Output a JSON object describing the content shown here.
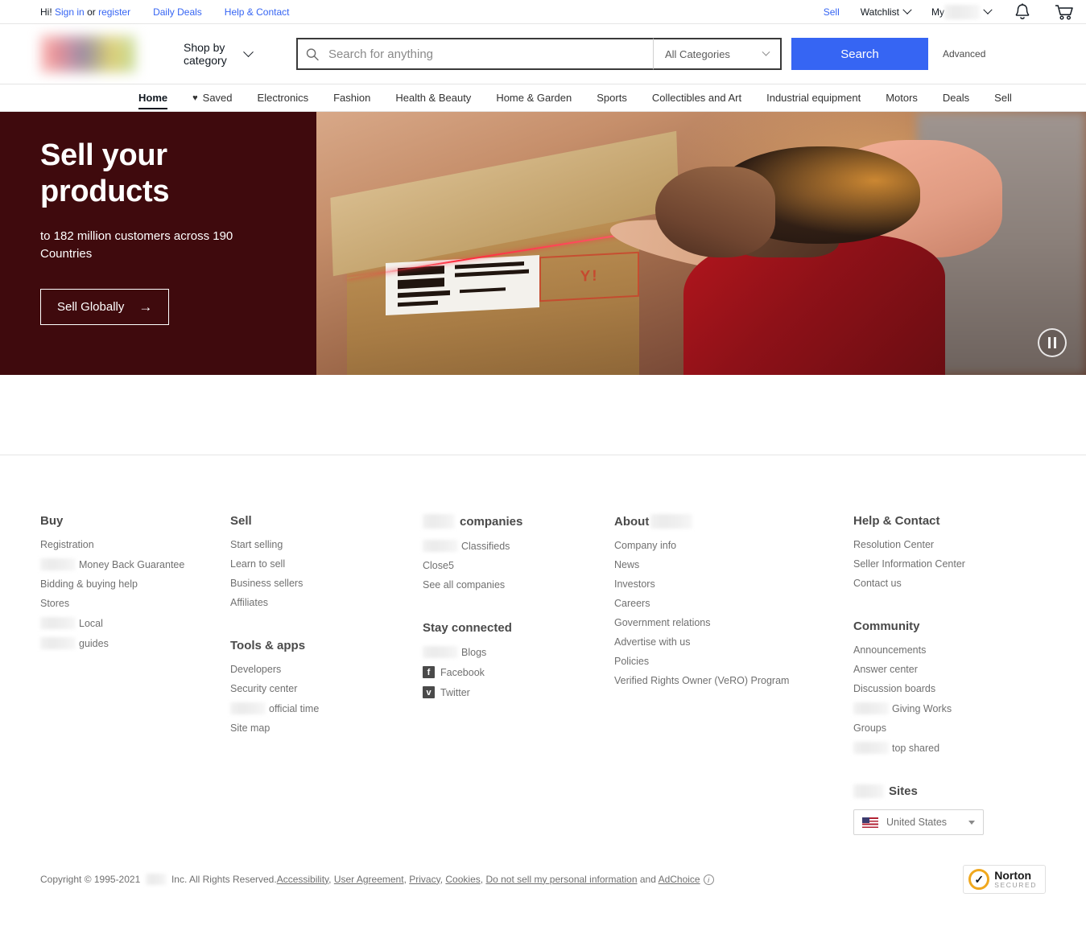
{
  "topbar": {
    "greeting": "Hi!",
    "sign_in": "Sign in",
    "or": "or",
    "register": "register",
    "daily_deals": "Daily Deals",
    "help_contact": "Help & Contact",
    "sell": "Sell",
    "watchlist": "Watchlist",
    "my_prefix": "My",
    "bell_icon": "bell-icon",
    "cart_icon": "cart-icon"
  },
  "header": {
    "logo_icon": "site-logo-redacted",
    "shop_by_line1": "Shop by",
    "shop_by_line2": "category",
    "search_placeholder": "Search for anything",
    "search_value": "",
    "search_icon": "search-icon",
    "category_selected": "All Categories",
    "search_button": "Search",
    "advanced": "Advanced"
  },
  "nav": {
    "items": [
      {
        "label": "Home",
        "active": true,
        "icon": ""
      },
      {
        "label": "Saved",
        "active": false,
        "icon": "heart-icon"
      },
      {
        "label": "Electronics",
        "active": false,
        "icon": ""
      },
      {
        "label": "Fashion",
        "active": false,
        "icon": ""
      },
      {
        "label": "Health & Beauty",
        "active": false,
        "icon": ""
      },
      {
        "label": "Home & Garden",
        "active": false,
        "icon": ""
      },
      {
        "label": "Sports",
        "active": false,
        "icon": ""
      },
      {
        "label": "Collectibles and Art",
        "active": false,
        "icon": ""
      },
      {
        "label": "Industrial equipment",
        "active": false,
        "icon": ""
      },
      {
        "label": "Motors",
        "active": false,
        "icon": ""
      },
      {
        "label": "Deals",
        "active": false,
        "icon": ""
      },
      {
        "label": "Sell",
        "active": false,
        "icon": ""
      }
    ]
  },
  "hero": {
    "title_line1": "Sell your",
    "title_line2": "products",
    "subtitle": "to 182 million customers across 190 Countries",
    "cta_label": "Sell Globally",
    "cta_arrow": "→",
    "bg_color": "#3f0a0d",
    "pause_icon": "pause-icon",
    "image_alt": "person scanning a cardboard package with a barcode scanner"
  },
  "footer": {
    "columns": [
      {
        "heading": "Buy",
        "links": [
          {
            "label": "Registration",
            "redacted_prefix": false
          },
          {
            "label": "Money Back Guarantee",
            "redacted_prefix": true
          },
          {
            "label": "Bidding & buying help",
            "redacted_prefix": false
          },
          {
            "label": "Stores",
            "redacted_prefix": false
          },
          {
            "label": "Local",
            "redacted_prefix": true
          },
          {
            "label": "guides",
            "redacted_prefix": true
          }
        ]
      },
      {
        "heading": "Sell",
        "links": [
          {
            "label": "Start selling",
            "redacted_prefix": false
          },
          {
            "label": "Learn to sell",
            "redacted_prefix": false
          },
          {
            "label": "Business sellers",
            "redacted_prefix": false
          },
          {
            "label": "Affiliates",
            "redacted_prefix": false
          }
        ],
        "heading2": "Tools & apps",
        "links2": [
          {
            "label": "Developers",
            "redacted_prefix": false
          },
          {
            "label": "Security center",
            "redacted_prefix": false
          },
          {
            "label": "official time",
            "redacted_prefix": true
          },
          {
            "label": "Site map",
            "redacted_prefix": false
          }
        ]
      },
      {
        "heading": "companies",
        "heading_redacted_prefix": true,
        "links": [
          {
            "label": "Classifieds",
            "redacted_prefix": true
          },
          {
            "label": "Close5",
            "redacted_prefix": false
          },
          {
            "label": "See all companies",
            "redacted_prefix": false
          }
        ],
        "heading2": "Stay connected",
        "links2": [
          {
            "label": "Blogs",
            "redacted_prefix": true,
            "icon": ""
          },
          {
            "label": "Facebook",
            "redacted_prefix": false,
            "icon": "facebook-icon",
            "glyph": "f"
          },
          {
            "label": "Twitter",
            "redacted_prefix": false,
            "icon": "twitter-icon",
            "glyph": "ᴠ"
          }
        ]
      },
      {
        "heading": "About",
        "heading_redacted_suffix": true,
        "links": [
          {
            "label": "Company info",
            "redacted_prefix": false
          },
          {
            "label": "News",
            "redacted_prefix": false
          },
          {
            "label": "Investors",
            "redacted_prefix": false
          },
          {
            "label": "Careers",
            "redacted_prefix": false
          },
          {
            "label": "Government relations",
            "redacted_prefix": false
          },
          {
            "label": "Advertise with us",
            "redacted_prefix": false
          },
          {
            "label": "Policies",
            "redacted_prefix": false
          },
          {
            "label": "Verified Rights Owner (VeRO) Program",
            "redacted_prefix": false
          }
        ]
      },
      {
        "heading": "Help & Contact",
        "links": [
          {
            "label": "Resolution Center",
            "redacted_prefix": false
          },
          {
            "label": "Seller Information Center",
            "redacted_prefix": false
          },
          {
            "label": "Contact us",
            "redacted_prefix": false
          }
        ],
        "heading2": "Community",
        "links2": [
          {
            "label": "Announcements",
            "redacted_prefix": false
          },
          {
            "label": "Answer center",
            "redacted_prefix": false
          },
          {
            "label": "Discussion boards",
            "redacted_prefix": false
          },
          {
            "label": "Giving Works",
            "redacted_prefix": true
          },
          {
            "label": "Groups",
            "redacted_prefix": false
          },
          {
            "label": "top shared",
            "redacted_prefix": true
          }
        ],
        "sites_heading": "Sites",
        "sites_heading_redacted_prefix": true,
        "site_selected": "United States",
        "site_flag_icon": "us-flag-icon"
      }
    ]
  },
  "legal": {
    "copyright_pre": "Copyright © 1995-2021",
    "copyright_post": "Inc. All Rights Reserved.",
    "links": [
      {
        "label": "Accessibility",
        "sep": ","
      },
      {
        "label": "User Agreement",
        "sep": ","
      },
      {
        "label": "Privacy",
        "sep": ","
      },
      {
        "label": "Cookies",
        "sep": ","
      },
      {
        "label": "Do not sell my personal information",
        "sep": ""
      }
    ],
    "and": "and",
    "adchoice": "AdChoice",
    "adchoice_icon": "info-icon",
    "norton_line1": "Norton",
    "norton_line2": "SECURED",
    "norton_icon": "norton-check-icon"
  }
}
